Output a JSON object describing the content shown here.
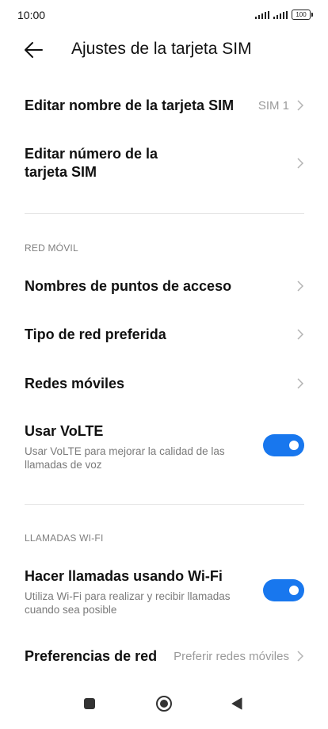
{
  "status": {
    "time": "10:00",
    "battery": "100"
  },
  "header": {
    "title": "Ajustes de la tarjeta SIM"
  },
  "items": {
    "edit_name": {
      "label": "Editar nombre de la tarjeta SIM",
      "value": "SIM 1"
    },
    "edit_number": {
      "label_line1": "Editar número de la",
      "label_line2": "tarjeta SIM"
    }
  },
  "sections": {
    "mobile": "RED MÓVIL",
    "wifi_calls": "LLAMADAS WI-FI"
  },
  "mobile_items": {
    "apn": "Nombres de puntos de acceso",
    "network_type": "Tipo de red preferida",
    "mobile_networks": "Redes móviles"
  },
  "volte": {
    "label": "Usar VoLTE",
    "desc": "Usar VoLTE para mejorar la calidad de las llamadas de voz",
    "enabled": true
  },
  "wifi_calling": {
    "label": "Hacer llamadas usando Wi-Fi",
    "desc": "Utiliza Wi-Fi para realizar y recibir llamadas cuando sea posible",
    "enabled": true
  },
  "network_pref": {
    "label": "Preferencias de red",
    "value": "Preferir redes móviles"
  },
  "colors": {
    "accent": "#1877ee",
    "chevron": "#b3b3b3",
    "secondary_text": "#7a7a7a"
  },
  "icons": {
    "back": "arrow-left-icon",
    "chevron": "chevron-right-icon",
    "recents": "square-icon",
    "home": "circle-icon",
    "back_nav": "triangle-left-icon"
  }
}
